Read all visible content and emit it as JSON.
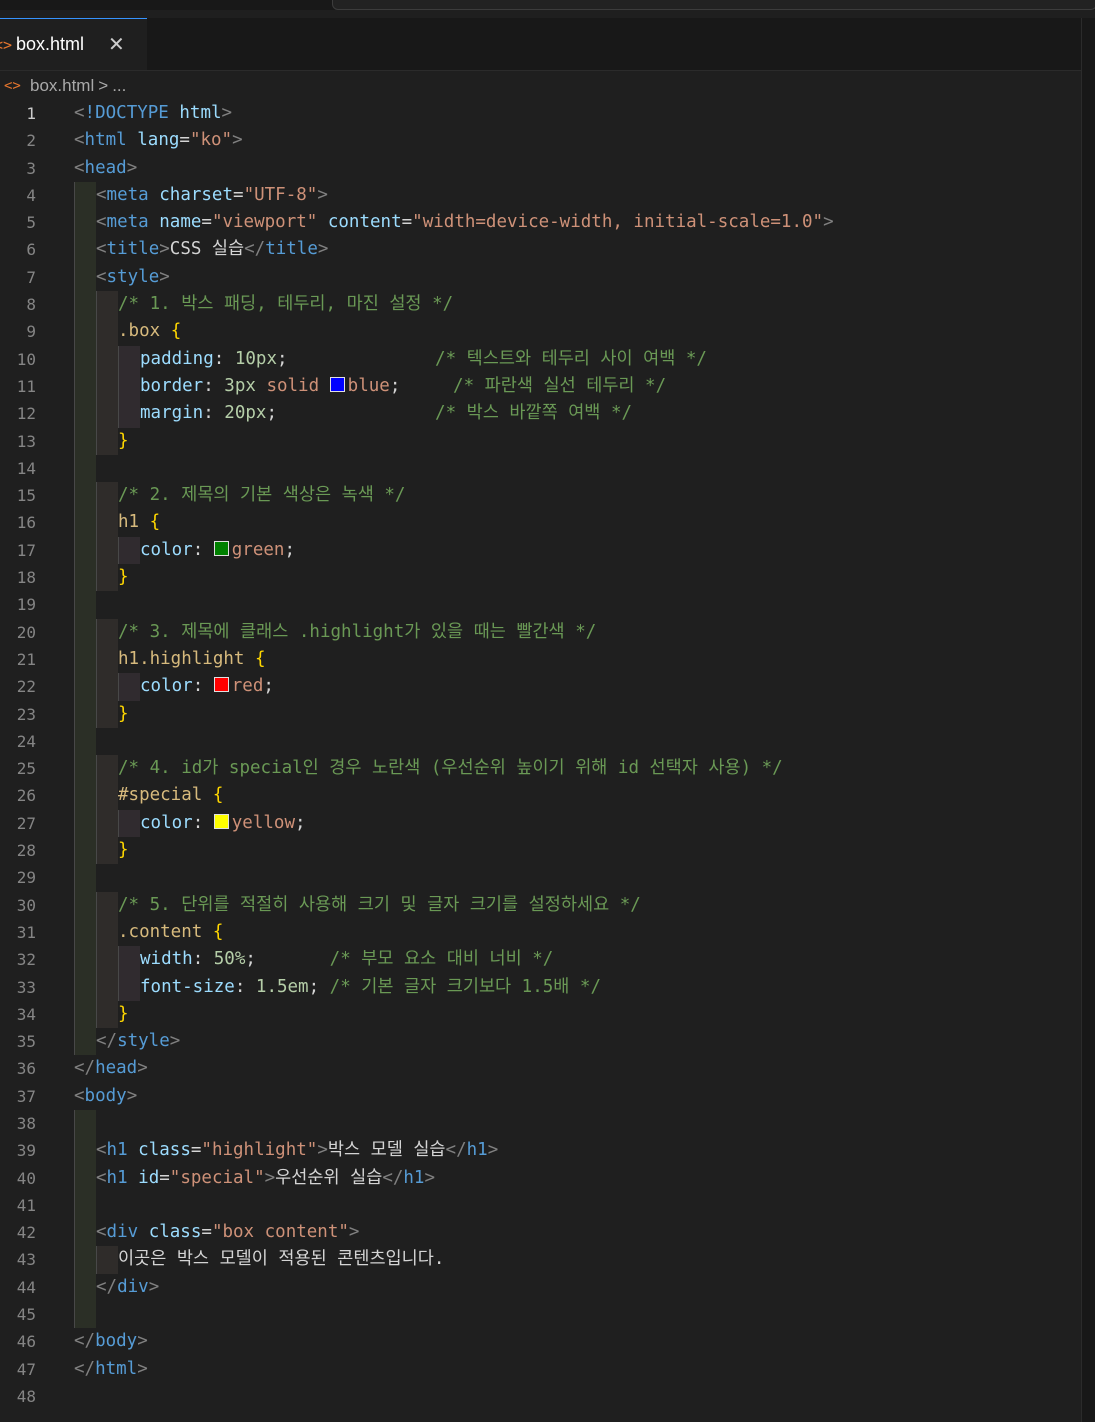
{
  "tab": {
    "icon": "<>",
    "label": "box.html",
    "close": "✕"
  },
  "breadcrumb": {
    "icon": "<>",
    "file": "box.html",
    "separator": ">",
    "more": "..."
  },
  "colors": {
    "blue": "#0000ff",
    "green": "#008000",
    "red": "#ff0000",
    "yellow": "#ffff00"
  },
  "lines": [
    {
      "n": "1",
      "ind": 0,
      "tok": [
        [
          "t",
          "<"
        ],
        [
          "tg",
          "!DOCTYPE"
        ],
        [
          "pun",
          " "
        ],
        [
          "at",
          "html"
        ],
        [
          "t",
          ">"
        ]
      ]
    },
    {
      "n": "2",
      "ind": 0,
      "tok": [
        [
          "t",
          "<"
        ],
        [
          "tg",
          "html"
        ],
        [
          "pun",
          " "
        ],
        [
          "at",
          "lang"
        ],
        [
          "pun",
          "="
        ],
        [
          "st",
          "\"ko\""
        ],
        [
          "t",
          ">"
        ]
      ]
    },
    {
      "n": "3",
      "ind": 0,
      "tok": [
        [
          "t",
          "<"
        ],
        [
          "tg",
          "head"
        ],
        [
          "t",
          ">"
        ]
      ]
    },
    {
      "n": "4",
      "ind": 1,
      "tok": [
        [
          "t",
          "<"
        ],
        [
          "tg",
          "meta"
        ],
        [
          "pun",
          " "
        ],
        [
          "at",
          "charset"
        ],
        [
          "pun",
          "="
        ],
        [
          "st",
          "\"UTF-8\""
        ],
        [
          "t",
          ">"
        ]
      ]
    },
    {
      "n": "5",
      "ind": 1,
      "tok": [
        [
          "t",
          "<"
        ],
        [
          "tg",
          "meta"
        ],
        [
          "pun",
          " "
        ],
        [
          "at",
          "name"
        ],
        [
          "pun",
          "="
        ],
        [
          "st",
          "\"viewport\""
        ],
        [
          "pun",
          " "
        ],
        [
          "at",
          "content"
        ],
        [
          "pun",
          "="
        ],
        [
          "st",
          "\"width=device-width, initial-scale=1.0\""
        ],
        [
          "t",
          ">"
        ]
      ]
    },
    {
      "n": "6",
      "ind": 1,
      "tok": [
        [
          "t",
          "<"
        ],
        [
          "tg",
          "title"
        ],
        [
          "t",
          ">"
        ],
        [
          "tx",
          "CSS 실습"
        ],
        [
          "t",
          "</"
        ],
        [
          "tg",
          "title"
        ],
        [
          "t",
          ">"
        ]
      ]
    },
    {
      "n": "7",
      "ind": 1,
      "tok": [
        [
          "t",
          "<"
        ],
        [
          "tg",
          "style"
        ],
        [
          "t",
          ">"
        ]
      ]
    },
    {
      "n": "8",
      "ind": 2,
      "tok": [
        [
          "cm",
          "/* 1. 박스 패딩, 테두리, 마진 설정 */"
        ]
      ]
    },
    {
      "n": "9",
      "ind": 2,
      "tok": [
        [
          "sel",
          ".box"
        ],
        [
          "pun",
          " "
        ],
        [
          "br",
          "{"
        ]
      ]
    },
    {
      "n": "10",
      "ind": 3,
      "tok": [
        [
          "pr",
          "padding"
        ],
        [
          "pun",
          ": "
        ],
        [
          "nu",
          "10px"
        ],
        [
          "pun",
          ";              "
        ],
        [
          "cm",
          "/* 텍스트와 테두리 사이 여백 */"
        ]
      ]
    },
    {
      "n": "11",
      "ind": 3,
      "tok": [
        [
          "pr",
          "border"
        ],
        [
          "pun",
          ": "
        ],
        [
          "nu",
          "3px"
        ],
        [
          "st",
          " solid "
        ],
        [
          "swatch",
          "blue"
        ],
        [
          "st",
          "blue"
        ],
        [
          "pun",
          ";     "
        ],
        [
          "cm",
          "/* 파란색 실선 테두리 */"
        ]
      ]
    },
    {
      "n": "12",
      "ind": 3,
      "tok": [
        [
          "pr",
          "margin"
        ],
        [
          "pun",
          ": "
        ],
        [
          "nu",
          "20px"
        ],
        [
          "pun",
          ";               "
        ],
        [
          "cm",
          "/* 박스 바깥쪽 여백 */"
        ]
      ]
    },
    {
      "n": "13",
      "ind": 2,
      "tok": [
        [
          "br",
          "}"
        ]
      ]
    },
    {
      "n": "14",
      "ind": 1,
      "tok": []
    },
    {
      "n": "15",
      "ind": 2,
      "tok": [
        [
          "cm",
          "/* 2. 제목의 기본 색상은 녹색 */"
        ]
      ]
    },
    {
      "n": "16",
      "ind": 2,
      "tok": [
        [
          "sel",
          "h1"
        ],
        [
          "pun",
          " "
        ],
        [
          "br",
          "{"
        ]
      ]
    },
    {
      "n": "17",
      "ind": 3,
      "tok": [
        [
          "pr",
          "color"
        ],
        [
          "pun",
          ": "
        ],
        [
          "swatch",
          "green"
        ],
        [
          "st",
          "green"
        ],
        [
          "pun",
          ";"
        ]
      ]
    },
    {
      "n": "18",
      "ind": 2,
      "tok": [
        [
          "br",
          "}"
        ]
      ]
    },
    {
      "n": "19",
      "ind": 1,
      "tok": []
    },
    {
      "n": "20",
      "ind": 2,
      "tok": [
        [
          "cm",
          "/* 3. 제목에 클래스 .highlight가 있을 때는 빨간색 */"
        ]
      ]
    },
    {
      "n": "21",
      "ind": 2,
      "tok": [
        [
          "sel",
          "h1.highlight"
        ],
        [
          "pun",
          " "
        ],
        [
          "br",
          "{"
        ]
      ]
    },
    {
      "n": "22",
      "ind": 3,
      "tok": [
        [
          "pr",
          "color"
        ],
        [
          "pun",
          ": "
        ],
        [
          "swatch",
          "red"
        ],
        [
          "st",
          "red"
        ],
        [
          "pun",
          ";"
        ]
      ]
    },
    {
      "n": "23",
      "ind": 2,
      "tok": [
        [
          "br",
          "}"
        ]
      ]
    },
    {
      "n": "24",
      "ind": 1,
      "tok": []
    },
    {
      "n": "25",
      "ind": 2,
      "tok": [
        [
          "cm",
          "/* 4. id가 special인 경우 노란색 (우선순위 높이기 위해 id 선택자 사용) */"
        ]
      ]
    },
    {
      "n": "26",
      "ind": 2,
      "tok": [
        [
          "sel",
          "#special"
        ],
        [
          "pun",
          " "
        ],
        [
          "br",
          "{"
        ]
      ]
    },
    {
      "n": "27",
      "ind": 3,
      "tok": [
        [
          "pr",
          "color"
        ],
        [
          "pun",
          ": "
        ],
        [
          "swatch",
          "yellow"
        ],
        [
          "st",
          "yellow"
        ],
        [
          "pun",
          ";"
        ]
      ]
    },
    {
      "n": "28",
      "ind": 2,
      "tok": [
        [
          "br",
          "}"
        ]
      ]
    },
    {
      "n": "29",
      "ind": 1,
      "tok": []
    },
    {
      "n": "30",
      "ind": 2,
      "tok": [
        [
          "cm",
          "/* 5. 단위를 적절히 사용해 크기 및 글자 크기를 설정하세요 */"
        ]
      ]
    },
    {
      "n": "31",
      "ind": 2,
      "tok": [
        [
          "sel",
          ".content"
        ],
        [
          "pun",
          " "
        ],
        [
          "br",
          "{"
        ]
      ]
    },
    {
      "n": "32",
      "ind": 3,
      "tok": [
        [
          "pr",
          "width"
        ],
        [
          "pun",
          ": "
        ],
        [
          "nu",
          "50%"
        ],
        [
          "pun",
          ";       "
        ],
        [
          "cm",
          "/* 부모 요소 대비 너비 */"
        ]
      ]
    },
    {
      "n": "33",
      "ind": 3,
      "tok": [
        [
          "pr",
          "font-size"
        ],
        [
          "pun",
          ": "
        ],
        [
          "nu",
          "1.5em"
        ],
        [
          "pun",
          "; "
        ],
        [
          "cm",
          "/* 기본 글자 크기보다 1.5배 */"
        ]
      ]
    },
    {
      "n": "34",
      "ind": 2,
      "tok": [
        [
          "br",
          "}"
        ]
      ]
    },
    {
      "n": "35",
      "ind": 1,
      "tok": [
        [
          "t",
          "</"
        ],
        [
          "tg",
          "style"
        ],
        [
          "t",
          ">"
        ]
      ]
    },
    {
      "n": "36",
      "ind": 0,
      "tok": [
        [
          "t",
          "</"
        ],
        [
          "tg",
          "head"
        ],
        [
          "t",
          ">"
        ]
      ]
    },
    {
      "n": "37",
      "ind": 0,
      "tok": [
        [
          "t",
          "<"
        ],
        [
          "tg",
          "body"
        ],
        [
          "t",
          ">"
        ]
      ]
    },
    {
      "n": "38",
      "ind": 1,
      "tok": []
    },
    {
      "n": "39",
      "ind": 1,
      "tok": [
        [
          "t",
          "<"
        ],
        [
          "tg",
          "h1"
        ],
        [
          "pun",
          " "
        ],
        [
          "at",
          "class"
        ],
        [
          "pun",
          "="
        ],
        [
          "st",
          "\"highlight\""
        ],
        [
          "t",
          ">"
        ],
        [
          "tx",
          "박스 모델 실습"
        ],
        [
          "t",
          "</"
        ],
        [
          "tg",
          "h1"
        ],
        [
          "t",
          ">"
        ]
      ]
    },
    {
      "n": "40",
      "ind": 1,
      "tok": [
        [
          "t",
          "<"
        ],
        [
          "tg",
          "h1"
        ],
        [
          "pun",
          " "
        ],
        [
          "at",
          "id"
        ],
        [
          "pun",
          "="
        ],
        [
          "st",
          "\"special\""
        ],
        [
          "t",
          ">"
        ],
        [
          "tx",
          "우선순위 실습"
        ],
        [
          "t",
          "</"
        ],
        [
          "tg",
          "h1"
        ],
        [
          "t",
          ">"
        ]
      ]
    },
    {
      "n": "41",
      "ind": 1,
      "tok": []
    },
    {
      "n": "42",
      "ind": 1,
      "tok": [
        [
          "t",
          "<"
        ],
        [
          "tg",
          "div"
        ],
        [
          "pun",
          " "
        ],
        [
          "at",
          "class"
        ],
        [
          "pun",
          "="
        ],
        [
          "st",
          "\"box content\""
        ],
        [
          "t",
          ">"
        ]
      ]
    },
    {
      "n": "43",
      "ind": 2,
      "tok": [
        [
          "tx",
          "이곳은 박스 모델이 적용된 콘텐츠입니다."
        ]
      ]
    },
    {
      "n": "44",
      "ind": 1,
      "tok": [
        [
          "t",
          "</"
        ],
        [
          "tg",
          "div"
        ],
        [
          "t",
          ">"
        ]
      ]
    },
    {
      "n": "45",
      "ind": 1,
      "tok": []
    },
    {
      "n": "46",
      "ind": 0,
      "tok": [
        [
          "t",
          "</"
        ],
        [
          "tg",
          "body"
        ],
        [
          "t",
          ">"
        ]
      ]
    },
    {
      "n": "47",
      "ind": 0,
      "tok": [
        [
          "t",
          "</"
        ],
        [
          "tg",
          "html"
        ],
        [
          "t",
          ">"
        ]
      ]
    },
    {
      "n": "48",
      "ind": 0,
      "tok": []
    }
  ]
}
